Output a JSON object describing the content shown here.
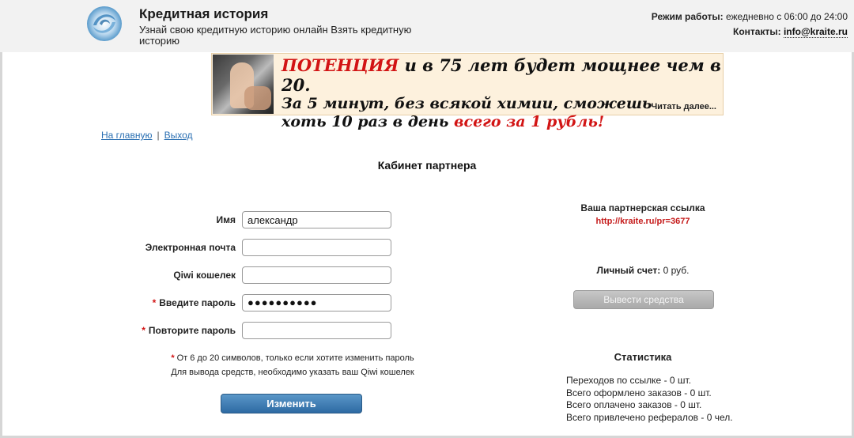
{
  "header": {
    "title": "Кредитная история",
    "subtitle": "Узнай свою кредитную историю онлайн Взять кредитную историю",
    "hours_label": "Режим работы:",
    "hours_value": "ежедневно с 06:00 до 24:00",
    "contacts_label": "Контакты:",
    "contacts_email": "info@kraite.ru",
    "logo_icon": "swirl-logo-icon"
  },
  "banner": {
    "line1_red": "ПОТЕНЦИЯ",
    "line1_rest": "и в 75 лет будет мощнее чем в 20.",
    "line2": "За 5 минут, без всякой химии, сможешь",
    "line3_start": "хоть 10 раз в день",
    "line3_red": "всего за 1 рубль!",
    "more": "Читать далее..."
  },
  "nav": {
    "home": "На главную",
    "separator": "|",
    "logout": "Выход"
  },
  "page": {
    "title": "Кабинет партнера"
  },
  "form": {
    "name_label": "Имя",
    "name_value": "александр",
    "email_label": "Электронная почта",
    "email_value": "",
    "qiwi_label": "Qiwi кошелек",
    "qiwi_value": "",
    "password_label": "Введите пароль",
    "password_mask": "●●●●●●●●●●",
    "repeat_label": "Повторите пароль",
    "repeat_value": "",
    "required_mark": "*",
    "note1": "От 6 до 20 символов, только если хотите изменить пароль",
    "note2": "Для вывода средств, необходимо указать ваш Qiwi кошелек",
    "submit": "Изменить"
  },
  "partner": {
    "link_title": "Ваша партнерская ссылка",
    "link_url": "http://kraite.ru/pr=3677",
    "balance_label": "Личный счет:",
    "balance_value": "0 руб.",
    "withdraw": "Вывести средства"
  },
  "stats": {
    "title": "Статистика",
    "items": [
      "Переходов по ссылке - 0 шт.",
      "Всего оформлено заказов - 0 шт.",
      "Всего оплачено заказов - 0 шт.",
      "Всего привлечено рефералов - 0 чел."
    ]
  },
  "colors": {
    "accent_red": "#d21414",
    "link_blue": "#2a6fb2",
    "button_blue": "#2d6aa3",
    "button_gray": "#a9a9a9"
  }
}
